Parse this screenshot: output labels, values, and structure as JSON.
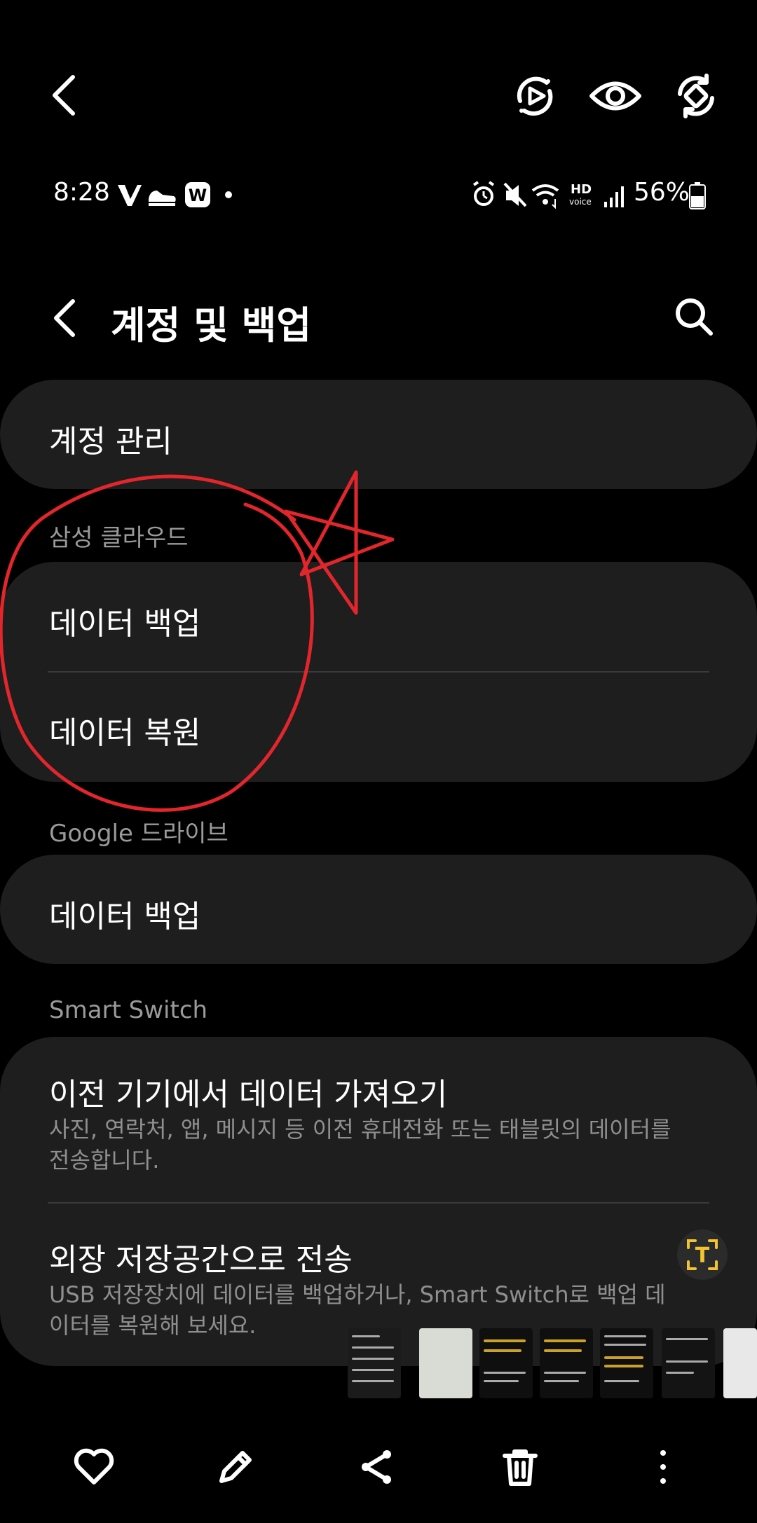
{
  "status_bar": {
    "time": "8:28",
    "battery": "56%"
  },
  "header": {
    "title": "계정 및 백업"
  },
  "account_card": {
    "label": "계정 관리"
  },
  "samsung_cloud": {
    "section_label": "삼성 클라우드",
    "backup_label": "데이터 백업",
    "restore_label": "데이터 복원"
  },
  "google_drive": {
    "section_label": "Google 드라이브",
    "backup_label": "데이터 백업"
  },
  "smart_switch": {
    "section_label": "Smart Switch",
    "import_title": "이전 기기에서 데이터 가져오기",
    "import_desc": "사진, 연락처, 앱, 메시지 등 이전 휴대전화 또는 태블릿의 데이터를 전송합니다.",
    "external_title": "외장 저장공간으로 전송",
    "external_desc": "USB 저장장치에 데이터를 백업하거나, Smart Switch로 백업 데이터를 복원해 보세요."
  },
  "colors": {
    "background": "#000000",
    "card": "#1e1e1e",
    "annotation": "#e3262c",
    "ocr_accent": "#f4c430"
  },
  "icons": {
    "viewer_toolbar": [
      "back-arrow-icon",
      "motion-play-icon",
      "eye-icon",
      "rotate-icon"
    ],
    "bottom_bar": [
      "heart-icon",
      "pencil-icon",
      "share-icon",
      "trash-icon",
      "more-vertical-icon"
    ]
  }
}
